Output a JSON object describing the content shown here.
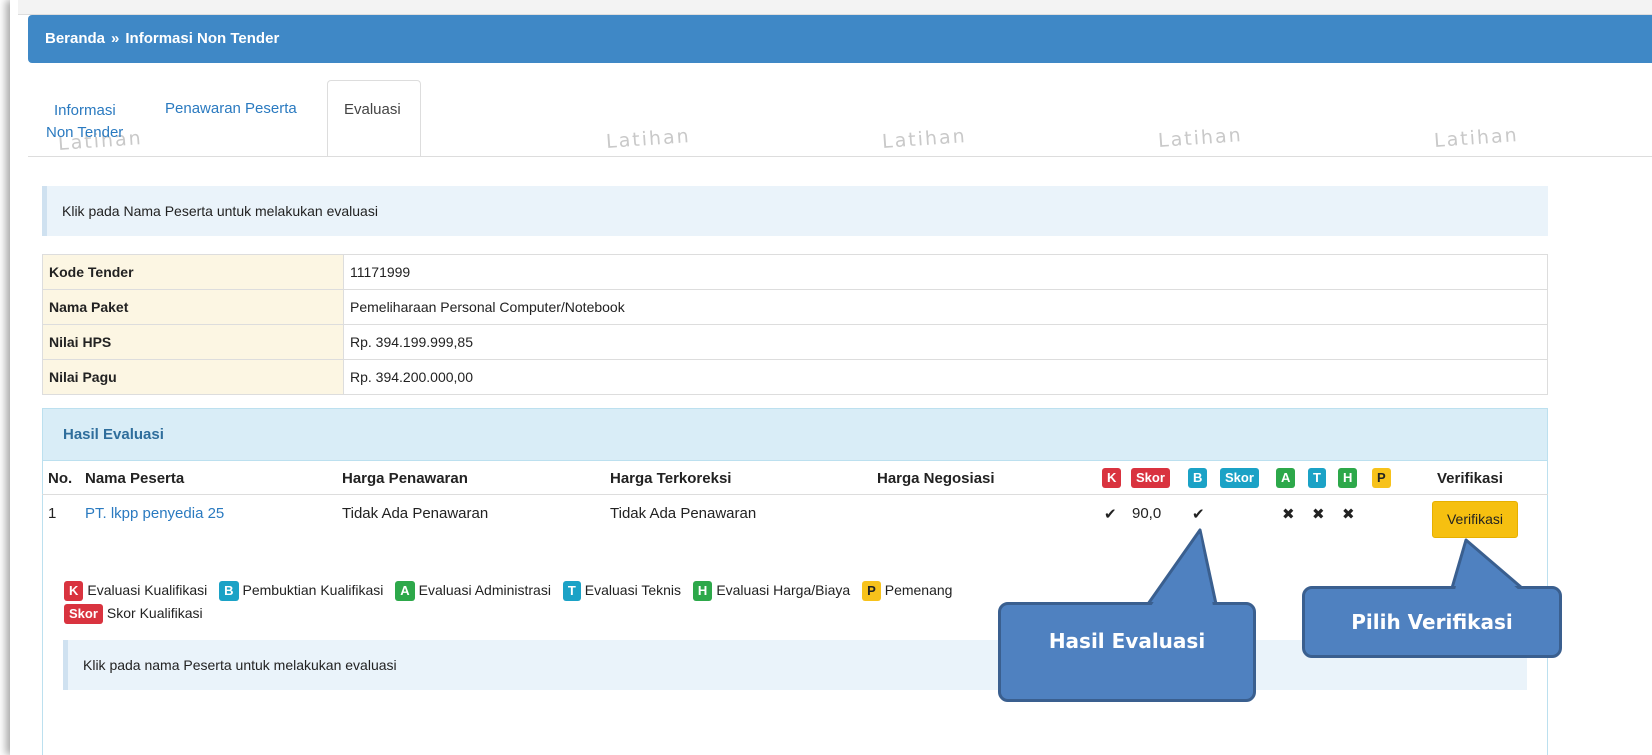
{
  "breadcrumb": {
    "home": "Beranda",
    "separator": "»",
    "current": "Informasi Non Tender"
  },
  "watermark": "Latihan",
  "tabs": [
    {
      "label_line1": "Informasi",
      "label_line2": "Non Tender"
    },
    {
      "label": "Penawaran Peserta"
    },
    {
      "label": "Evaluasi"
    }
  ],
  "info_text": "Klik pada Nama Peserta untuk melakukan evaluasi",
  "details": [
    {
      "label": "Kode Tender",
      "value": "11171999"
    },
    {
      "label": "Nama Paket",
      "value": "Pemeliharaan Personal Computer/Notebook"
    },
    {
      "label": "Nilai HPS",
      "value": "Rp. 394.199.999,85"
    },
    {
      "label": "Nilai Pagu",
      "value": "Rp. 394.200.000,00"
    }
  ],
  "panel_title": "Hasil Evaluasi",
  "columns": {
    "no": "No.",
    "nama": "Nama Peserta",
    "harga_penawaran": "Harga Penawaran",
    "harga_terkoreksi": "Harga Terkoreksi",
    "harga_negosiasi": "Harga Negosiasi",
    "verifikasi": "Verifikasi"
  },
  "badges": {
    "k": "K",
    "skor": "Skor",
    "b": "B",
    "a": "A",
    "t": "T",
    "h": "H",
    "p": "P"
  },
  "colors": {
    "red": "#d9333f",
    "teal": "#1ba2c6",
    "green": "#2da84a",
    "yellow": "#f7c21b",
    "header_blue": "#3f88c6"
  },
  "rows": [
    {
      "no": "1",
      "nama": "PT. lkpp penyedia 25",
      "harga_penawaran": "Tidak Ada Penawaran",
      "harga_terkoreksi": "Tidak Ada Penawaran",
      "harga_negosiasi": "",
      "k": "✔",
      "skor_k": "90,0",
      "b": "✔",
      "a": "✖",
      "t": "✖",
      "h": "✖",
      "verifikasi_button": "Verifikasi"
    }
  ],
  "legend": {
    "k": "Evaluasi Kualifikasi",
    "b": "Pembuktian Kualifikasi",
    "a": "Evaluasi Administrasi",
    "t": "Evaluasi Teknis",
    "h": "Evaluasi Harga/Biaya",
    "p": "Pemenang",
    "skor": "Skor Kualifikasi"
  },
  "info_text2": "Klik pada nama Peserta untuk melakukan evaluasi",
  "callouts": {
    "hasil": "Hasil Evaluasi",
    "pilih": "Pilih Verifikasi"
  }
}
